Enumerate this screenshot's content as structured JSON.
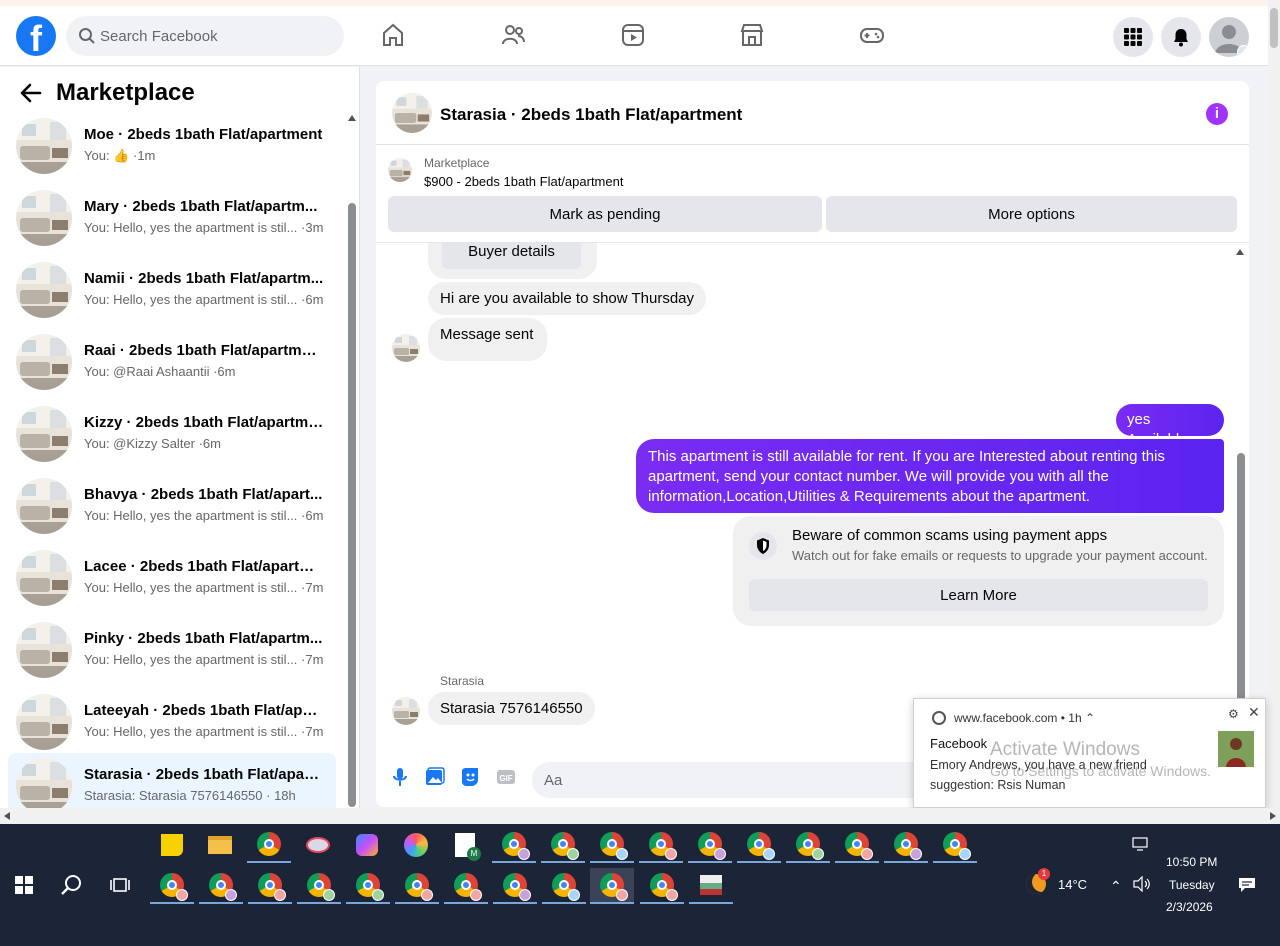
{
  "search": {
    "placeholder": "Search Facebook"
  },
  "sidebar": {
    "title": "Marketplace",
    "conversations": [
      {
        "name": "Moe · 2beds 1bath Flat/apartment",
        "preview_prefix": "You: ",
        "preview": "",
        "time": "1m",
        "like": true
      },
      {
        "name": "Mary · 2beds 1bath Flat/apartm...",
        "preview": "You: Hello, yes the apartment is stil... ·3m"
      },
      {
        "name": "Namii · 2beds 1bath Flat/apartm...",
        "preview": "You: Hello, yes the apartment is stil... ·6m"
      },
      {
        "name": "Raai · 2beds 1bath Flat/apartment",
        "preview": "You: @Raai Ashaantii ·6m"
      },
      {
        "name": "Kizzy · 2beds 1bath Flat/apartme...",
        "preview": "You: @Kizzy Salter ·6m"
      },
      {
        "name": "Bhavya · 2beds 1bath Flat/apart...",
        "preview": "You: Hello, yes the apartment is stil... ·6m"
      },
      {
        "name": "Lacee · 2beds 1bath Flat/apartm...",
        "preview": "You: Hello, yes the apartment is stil... ·7m"
      },
      {
        "name": "Pinky · 2beds 1bath Flat/apartm...",
        "preview": "You: Hello, yes the apartment is stil... ·7m"
      },
      {
        "name": "Lateeyah · 2beds 1bath Flat/apar...",
        "preview": "You: Hello, yes the apartment is stil... ·7m"
      },
      {
        "name": "Starasia · 2beds 1bath Flat/apart...",
        "preview": "Starasia: Starasia 7576146550 · 18h"
      }
    ]
  },
  "chat": {
    "title": "Starasia · 2beds 1bath Flat/apartment",
    "listing": {
      "source": "Marketplace",
      "price_line": "$900 - 2beds 1bath Flat/apartment",
      "pending_label": "Mark as pending",
      "more_label": "More options"
    },
    "messages": {
      "buyer_details": "Buyer details",
      "in1": "Hi are you available to show Thursday",
      "in2": "Message sent",
      "out1": "yes Available",
      "out2": "This apartment is still available for rent. If you are Interested about renting this apartment, send your contact number. We will provide you with all the information,Location,Utilities & Requirements about the apartment.",
      "sender_label": "Starasia",
      "in3": "Starasia 7576146550"
    },
    "scam_card": {
      "title": "Beware of common scams using payment apps",
      "text": "Watch out for fake emails or requests to upgrade your payment account.",
      "button": "Learn More"
    },
    "composer": {
      "placeholder": "Aa"
    }
  },
  "notification": {
    "site": "www.facebook.com",
    "age": "1h",
    "app": "Facebook",
    "body": "Emory Andrews, you have a new friend suggestion: Rsis Numan"
  },
  "watermark": {
    "line1": "Activate Windows",
    "line2": "Go to Settings to activate Windows."
  },
  "taskbar": {
    "temperature": "14°C",
    "weather_badge": "1",
    "time": "10:50 PM",
    "day": "Tuesday",
    "date": "2/3/2026"
  },
  "colors": {
    "brand": "#1877f2",
    "outgoing": "#6023f4",
    "info": "#a033ff"
  }
}
